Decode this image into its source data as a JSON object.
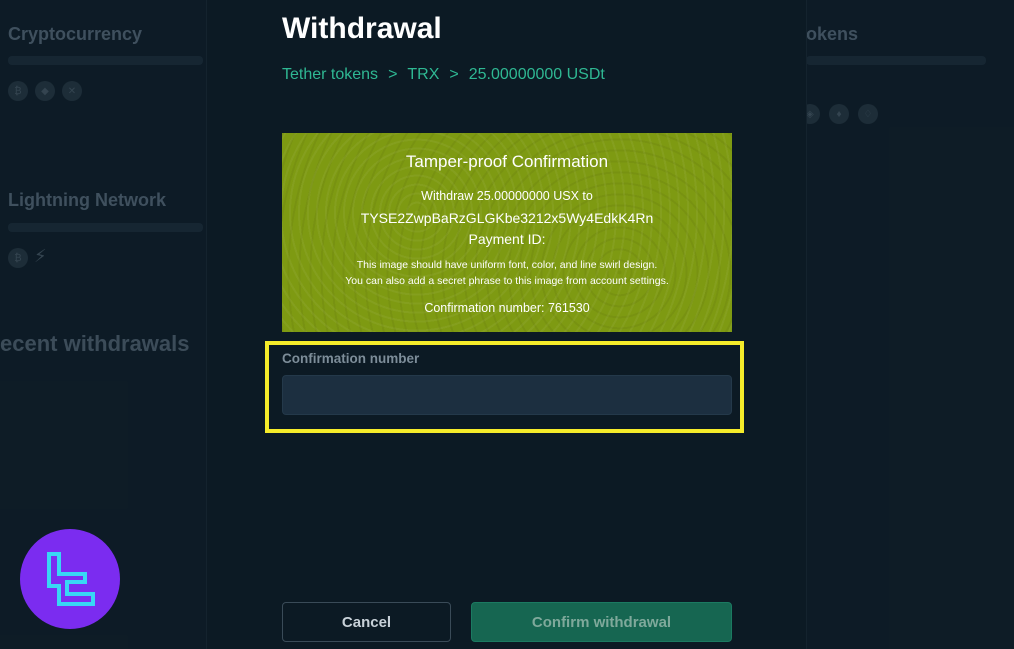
{
  "background": {
    "left_card_1_title": "Cryptocurrency",
    "left_card_2_title": "Lightning Network",
    "recent_heading": "ecent withdrawals",
    "right_card_title": "okens"
  },
  "modal": {
    "title": "Withdrawal",
    "breadcrumb": [
      "Tether tokens",
      "TRX",
      "25.00000000 USDt"
    ],
    "breadcrumb_separator": ">",
    "tamper": {
      "title": "Tamper-proof Confirmation",
      "line1": "Withdraw 25.00000000 USX to",
      "address": "TYSE2ZwpBaRzGLGKbe3212x5Wy4EdkK4Rn",
      "payment_id": "Payment ID:",
      "note1": "This image should have uniform font, color,  and line swirl design.",
      "note2": "You can also add a secret phrase to this image from account settings.",
      "confirmation": "Confirmation number: 761530"
    },
    "field": {
      "label": "Confirmation number",
      "value": ""
    },
    "buttons": {
      "cancel": "Cancel",
      "confirm": "Confirm withdrawal"
    }
  },
  "colors": {
    "accent_green": "#2fb893",
    "tamper_bg": "#7e9a12",
    "highlight": "#f6ec2a",
    "logo_purple": "#7b2cf0",
    "logo_cyan": "#38d6f5"
  }
}
